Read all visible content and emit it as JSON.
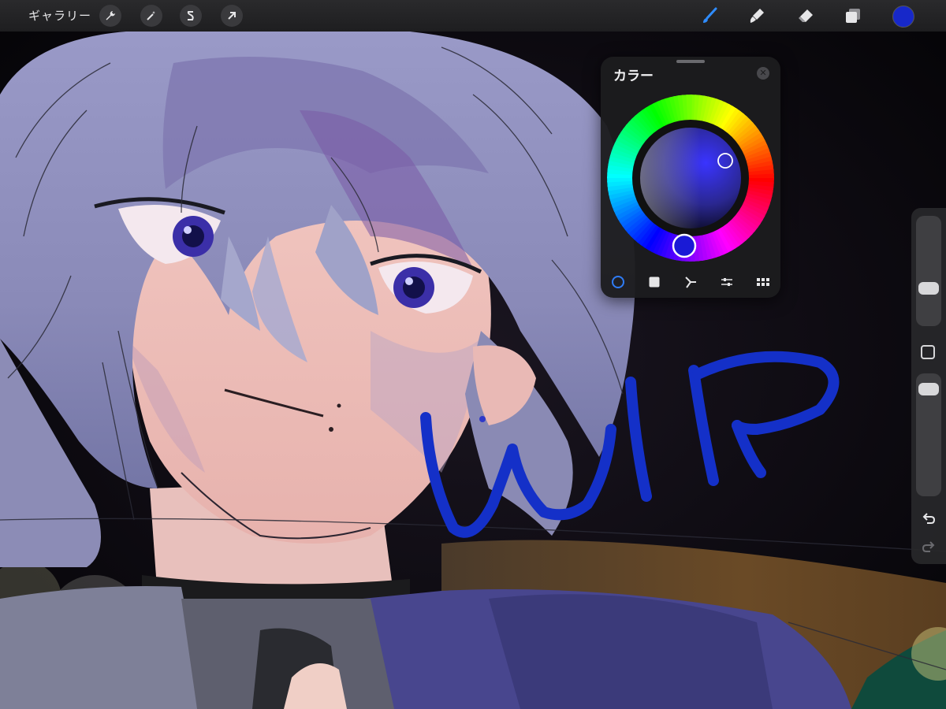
{
  "topbar": {
    "gallery_label": "ギャラリー",
    "left_tools": [
      {
        "name": "actions",
        "icon": "wrench-icon"
      },
      {
        "name": "adjustments",
        "icon": "magic-wand-icon"
      },
      {
        "name": "selection",
        "icon": "selection-s-icon"
      },
      {
        "name": "transform",
        "icon": "arrow-cursor-icon"
      }
    ],
    "right_tools": [
      {
        "name": "brush",
        "icon": "paintbrush-icon",
        "active": true
      },
      {
        "name": "smudge",
        "icon": "smudge-icon",
        "active": false
      },
      {
        "name": "eraser",
        "icon": "eraser-icon",
        "active": false
      },
      {
        "name": "layers",
        "icon": "layers-icon",
        "active": false
      }
    ],
    "current_color": "#1728c9"
  },
  "color_panel": {
    "title": "カラー",
    "close_icon": "close-x-icon",
    "mode": "disc",
    "tabs": [
      {
        "name": "disc",
        "icon": "circle-icon",
        "active": true
      },
      {
        "name": "classic",
        "icon": "square-icon",
        "active": false
      },
      {
        "name": "harmony",
        "icon": "harmony-icon",
        "active": false
      },
      {
        "name": "value",
        "icon": "sliders-icon",
        "active": false
      },
      {
        "name": "palettes",
        "icon": "grid-icon",
        "active": false
      }
    ],
    "selected_hue_color": "#1a1ad6",
    "active_tab_color": "#2f7cf6"
  },
  "sidebar": {
    "size_level": 0.3,
    "opacity_level": 0.95,
    "modify_icon": "square-outline-icon",
    "undo_icon": "undo-arrow-icon",
    "redo_icon": "redo-arrow-icon"
  },
  "canvas": {
    "overlay_text": "WIP",
    "overlay_color": "#1430c8"
  }
}
